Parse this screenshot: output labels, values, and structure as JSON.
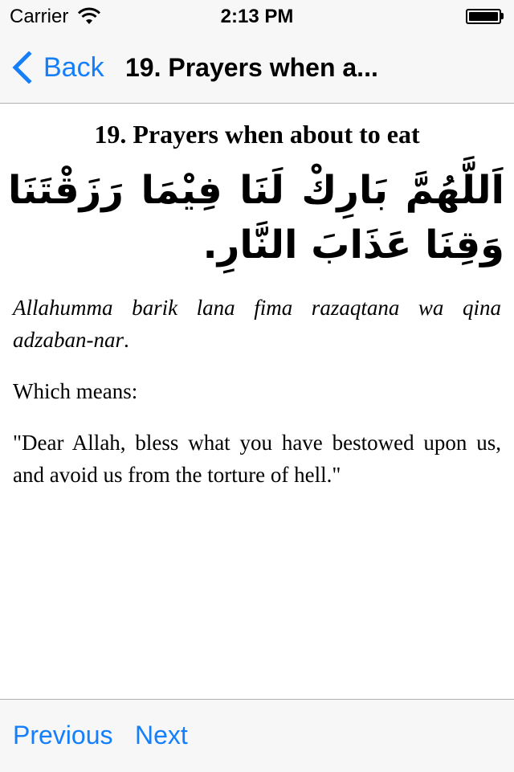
{
  "status_bar": {
    "carrier": "Carrier",
    "time": "2:13 PM",
    "wifi_icon": "wifi-icon",
    "battery_icon": "battery-icon",
    "battery_level": 1.0
  },
  "nav_bar": {
    "back_label": "Back",
    "back_icon": "chevron-left-icon",
    "title": "19. Prayers when a..."
  },
  "content": {
    "title": "19. Prayers when about to eat",
    "arabic": "اَللَّهُمَّ بَارِكْ لَنَا فِيْمَا رَزَقْتَنَا وَقِنَا عَذَابَ النَّارِ.",
    "transliteration_text": "Allahumma barik lana fima razaqtana wa qina adzaban-nar",
    "transliteration_end": ".",
    "meaning_label": "Which means:",
    "meaning": "\"Dear Allah, bless what you have bestowed upon us, and avoid us from the torture of hell.\""
  },
  "toolbar": {
    "previous_label": "Previous",
    "next_label": "Next"
  },
  "colors": {
    "accent": "#147efb",
    "bar_background": "#f7f7f7",
    "separator": "#b2b2b2"
  }
}
